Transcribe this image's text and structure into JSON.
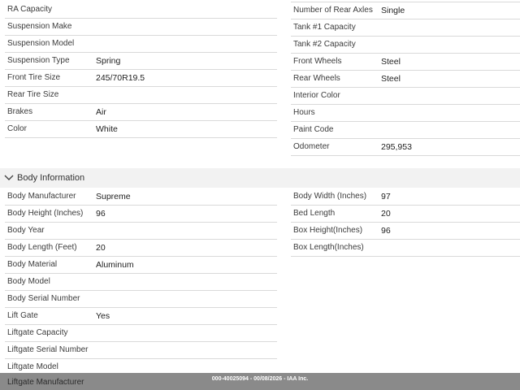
{
  "vehicle_left": [
    {
      "label": "RA Capacity",
      "value": ""
    },
    {
      "label": "Suspension Make",
      "value": ""
    },
    {
      "label": "Suspension Model",
      "value": ""
    },
    {
      "label": "Suspension Type",
      "value": "Spring"
    },
    {
      "label": "Front Tire Size",
      "value": "245/70R19.5"
    },
    {
      "label": "Rear Tire Size",
      "value": ""
    },
    {
      "label": "Brakes",
      "value": "Air"
    },
    {
      "label": "Color",
      "value": "White"
    }
  ],
  "vehicle_right": [
    {
      "label": "Number of Rear Axles",
      "value": "Single"
    },
    {
      "label": "Tank #1 Capacity",
      "value": ""
    },
    {
      "label": "Tank #2 Capacity",
      "value": ""
    },
    {
      "label": "Front Wheels",
      "value": "Steel"
    },
    {
      "label": "Rear Wheels",
      "value": "Steel"
    },
    {
      "label": "Interior Color",
      "value": ""
    },
    {
      "label": "Hours",
      "value": ""
    },
    {
      "label": "Paint Code",
      "value": ""
    },
    {
      "label": "Odometer",
      "value": "295,953"
    }
  ],
  "body_section": {
    "title": "Body Information",
    "left": [
      {
        "label": "Body Manufacturer",
        "value": "Supreme"
      },
      {
        "label": "Body Height (Inches)",
        "value": "96"
      },
      {
        "label": "Body Year",
        "value": ""
      },
      {
        "label": "Body Length (Feet)",
        "value": "20"
      },
      {
        "label": "Body Material",
        "value": "Aluminum"
      },
      {
        "label": "Body Model",
        "value": ""
      },
      {
        "label": "Body Serial Number",
        "value": ""
      },
      {
        "label": "Lift Gate",
        "value": "Yes"
      },
      {
        "label": "Liftgate Capacity",
        "value": ""
      },
      {
        "label": "Liftgate Serial Number",
        "value": ""
      },
      {
        "label": "Liftgate Model",
        "value": ""
      }
    ],
    "right": [
      {
        "label": "Body Width (Inches)",
        "value": "97"
      },
      {
        "label": "Bed Length",
        "value": "20"
      },
      {
        "label": "Box Height(Inches)",
        "value": "96"
      },
      {
        "label": "Box Length(Inches)",
        "value": ""
      }
    ],
    "peek_label": "Liftgate Manufacturer"
  },
  "footer": {
    "text": "000-40025094 - 00/08/2026 - IAA Inc."
  },
  "icons": {
    "section_toggle": "chevron-down-icon"
  },
  "colors": {
    "section_bg": "#f2f2f2",
    "divider": "#d9d9d9",
    "footer_bg": "#8a8a8a"
  }
}
